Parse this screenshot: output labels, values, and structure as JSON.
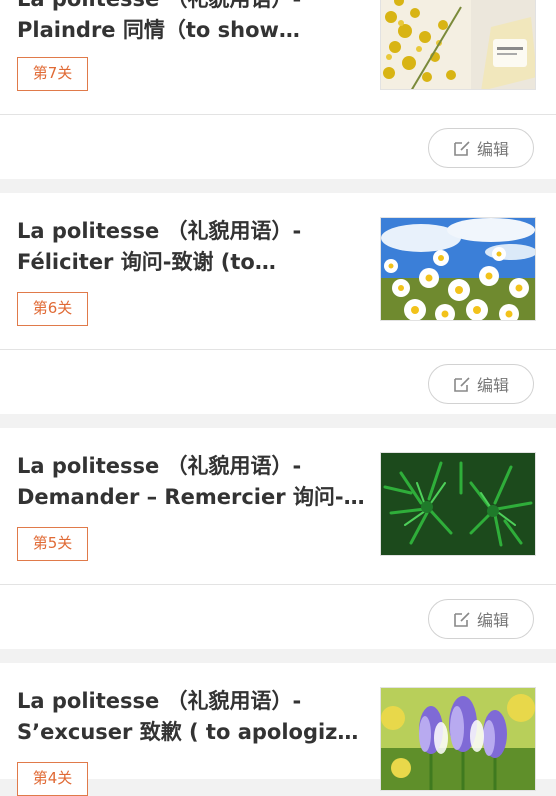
{
  "edit_icon": "edit-icon",
  "colors": {
    "badge": "#e06a35",
    "background": "#f2f2f2",
    "card": "#ffffff"
  },
  "lessons": [
    {
      "title_line1": "La politesse （礼貌用语）-",
      "title_line2": "Plaindre 同情（to show…",
      "badge": "第7关",
      "edit_label": "编辑",
      "image": "mimosa-perfume-photo"
    },
    {
      "title_line1": "La politesse （礼貌用语）-",
      "title_line2": "Féliciter 询问-致谢 (to…",
      "badge": "第6关",
      "edit_label": "编辑",
      "image": "daisies-sky-photo"
    },
    {
      "title_line1": "La politesse （礼貌用语）-",
      "title_line2": "Demander – Remercier 询问-致…",
      "badge": "第5关",
      "edit_label": "编辑",
      "image": "pine-branch-photo"
    },
    {
      "title_line1": "La politesse （礼貌用语）-",
      "title_line2": "S’excuser 致歉 ( to apologize )",
      "badge": "第4关",
      "edit_label": "编辑",
      "image": "crocus-flowers-photo"
    }
  ]
}
